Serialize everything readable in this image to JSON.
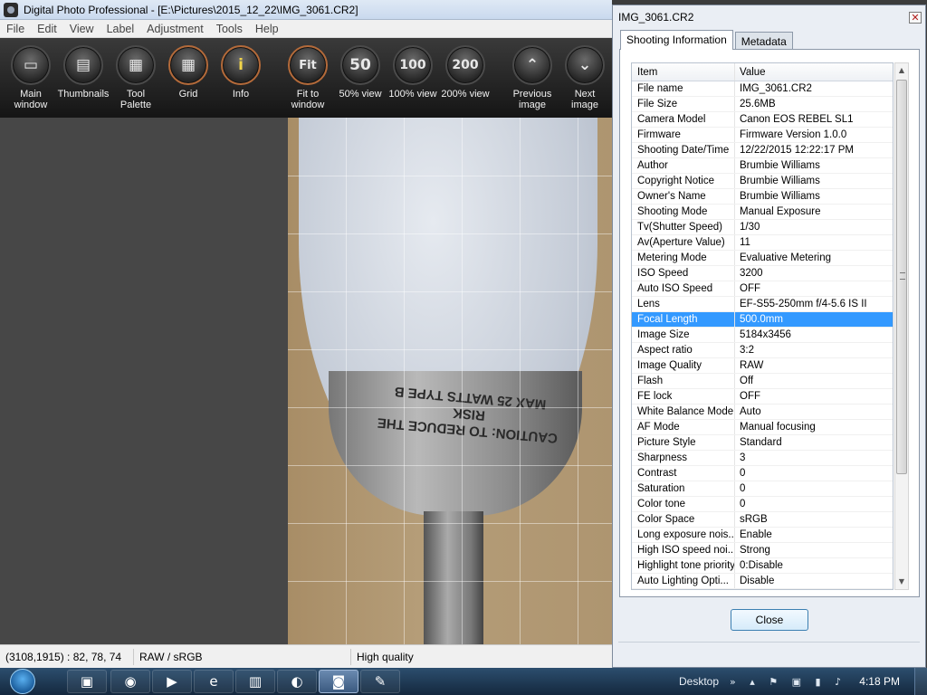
{
  "main_window": {
    "title": "Digital Photo Professional - [E:\\Pictures\\2015_12_22\\IMG_3061.CR2]",
    "menu": [
      "File",
      "Edit",
      "View",
      "Label",
      "Adjustment",
      "Tools",
      "Help"
    ]
  },
  "toolbar": [
    {
      "label": "Main\nwindow",
      "icon": "main-window-icon",
      "glyph": "▭"
    },
    {
      "label": "Thumbnails",
      "icon": "thumbnails-icon",
      "glyph": "▤"
    },
    {
      "label": "Tool\nPalette",
      "icon": "tool-palette-icon",
      "glyph": "▦"
    },
    {
      "label": "Grid",
      "icon": "grid-icon",
      "glyph": "▦"
    },
    {
      "label": "Info",
      "icon": "info-icon",
      "glyph": "i"
    },
    {
      "label": "Fit to\nwindow",
      "icon": "fit-icon",
      "glyph": "Fit"
    },
    {
      "label": "50% view",
      "icon": "zoom-50-icon",
      "glyph": "50"
    },
    {
      "label": "100% view",
      "icon": "zoom-100-icon",
      "glyph": "100"
    },
    {
      "label": "200% view",
      "icon": "zoom-200-icon",
      "glyph": "200"
    },
    {
      "label": "Previous\nimage",
      "icon": "previous-icon",
      "glyph": "⌃"
    },
    {
      "label": "Next\nimage",
      "icon": "next-icon",
      "glyph": "⌄"
    }
  ],
  "image_print": "CAUTION: TO REDUCE THE RISK\nMAX 25 WATTS TYPE B",
  "status_bar": {
    "coords": "(3108,1915) :  82, 78, 74",
    "format": "RAW / sRGB",
    "quality": "High quality"
  },
  "dialog": {
    "title": "IMG_3061.CR2",
    "close_x": "✕",
    "tabs": [
      "Shooting Information",
      "Metadata"
    ],
    "columns": {
      "item": "Item",
      "value": "Value"
    },
    "rows": [
      {
        "item": "File name",
        "value": "IMG_3061.CR2"
      },
      {
        "item": "File Size",
        "value": "25.6MB"
      },
      {
        "item": "Camera Model",
        "value": "Canon EOS REBEL SL1"
      },
      {
        "item": "Firmware",
        "value": "Firmware Version 1.0.0"
      },
      {
        "item": "Shooting Date/Time",
        "value": "12/22/2015 12:22:17 PM"
      },
      {
        "item": "Author",
        "value": "Brumbie Williams"
      },
      {
        "item": "Copyright Notice",
        "value": "Brumbie Williams"
      },
      {
        "item": "Owner's Name",
        "value": "Brumbie Williams"
      },
      {
        "item": "Shooting Mode",
        "value": "Manual Exposure"
      },
      {
        "item": "Tv(Shutter Speed)",
        "value": "1/30"
      },
      {
        "item": "Av(Aperture Value)",
        "value": "11"
      },
      {
        "item": "Metering Mode",
        "value": "Evaluative Metering"
      },
      {
        "item": "ISO Speed",
        "value": "3200"
      },
      {
        "item": "Auto ISO Speed",
        "value": "OFF"
      },
      {
        "item": "Lens",
        "value": "EF-S55-250mm f/4-5.6 IS II"
      },
      {
        "item": "Focal Length",
        "value": "500.0mm",
        "selected": true
      },
      {
        "item": "Image Size",
        "value": "5184x3456"
      },
      {
        "item": "Aspect ratio",
        "value": "3:2"
      },
      {
        "item": "Image Quality",
        "value": "RAW"
      },
      {
        "item": "Flash",
        "value": "Off"
      },
      {
        "item": "FE lock",
        "value": "OFF"
      },
      {
        "item": "White Balance Mode",
        "value": "Auto"
      },
      {
        "item": "AF Mode",
        "value": "Manual focusing"
      },
      {
        "item": "Picture Style",
        "value": "Standard"
      },
      {
        "item": "Sharpness",
        "value": "3"
      },
      {
        "item": "Contrast",
        "value": "0"
      },
      {
        "item": "Saturation",
        "value": "0"
      },
      {
        "item": "Color tone",
        "value": "0"
      },
      {
        "item": "Color Space",
        "value": "sRGB"
      },
      {
        "item": "Long exposure nois...",
        "value": "Enable"
      },
      {
        "item": "High ISO speed noi...",
        "value": "Strong"
      },
      {
        "item": "Highlight tone priority",
        "value": "0:Disable"
      },
      {
        "item": "Auto Lighting Opti...",
        "value": "Disable"
      }
    ],
    "close_button": "Close"
  },
  "taskbar": {
    "apps": [
      {
        "name": "file-explorer-icon",
        "glyph": "▣",
        "active": false
      },
      {
        "name": "chrome-icon",
        "glyph": "◉",
        "active": false
      },
      {
        "name": "media-player-icon",
        "glyph": "▶",
        "active": false
      },
      {
        "name": "internet-explorer-icon",
        "glyph": "e",
        "active": false
      },
      {
        "name": "remote-desktop-icon",
        "glyph": "▥",
        "active": false
      },
      {
        "name": "photo-viewer-icon",
        "glyph": "◐",
        "active": false
      },
      {
        "name": "digital-photo-professional-icon",
        "glyph": "◙",
        "active": true
      },
      {
        "name": "paint-icon",
        "glyph": "✎",
        "active": false
      }
    ],
    "desktop_label": "Desktop",
    "tray_icons": "» ▴ ⚑ ▣ ▮ ♪",
    "clock": "4:18 PM"
  }
}
